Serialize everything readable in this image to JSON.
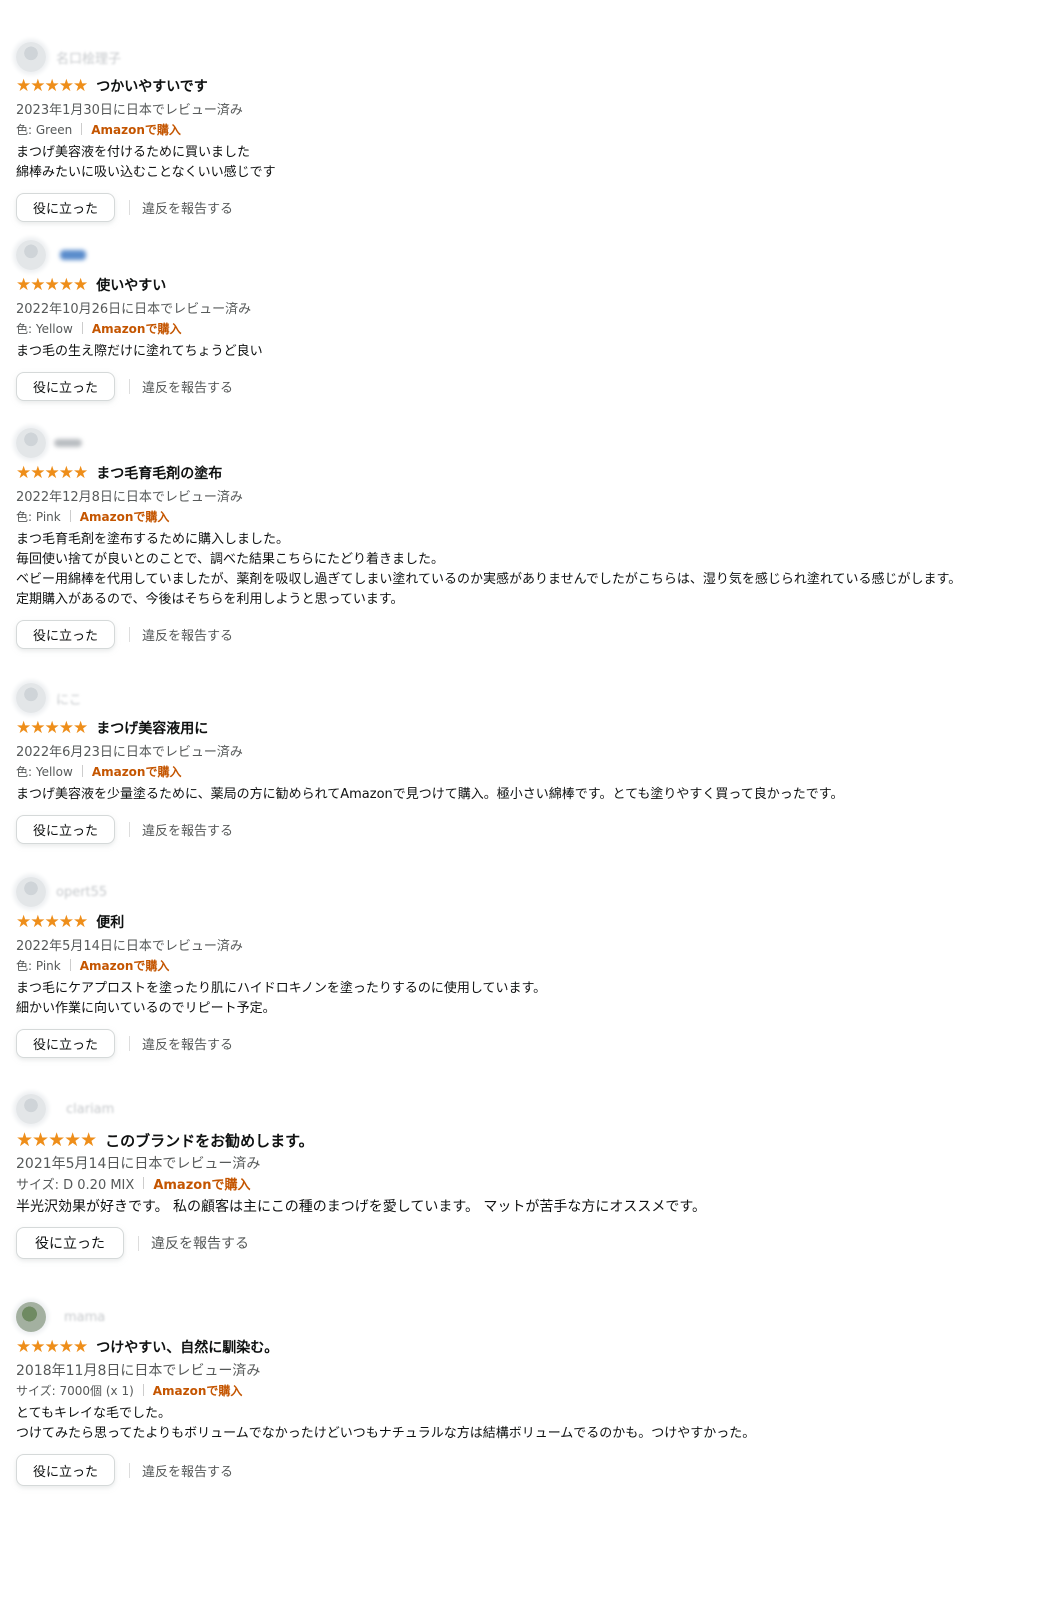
{
  "reviews": [
    {
      "profile_name": "名口桧理子",
      "stars": "★★★★★",
      "title": "つかいやすいです",
      "date": "2023年1月30日に日本でレビュー済み",
      "variant": "色: Green",
      "verified": "Amazonで購入",
      "body": [
        "まつげ美容液を付けるために買いました",
        "綿棒みたいに吸い込むことなくいい感じです"
      ],
      "helpful_label": "役に立った",
      "report_label": "違反を報告する"
    },
    {
      "profile_name": "",
      "stars": "★★★★★",
      "title": "使いやすい",
      "date": "2022年10月26日に日本でレビュー済み",
      "variant": "色: Yellow",
      "verified": "Amazonで購入",
      "body": [
        "まつ毛の生え際だけに塗れてちょうど良い"
      ],
      "helpful_label": "役に立った",
      "report_label": "違反を報告する"
    },
    {
      "profile_name": "",
      "stars": "★★★★★",
      "title": "まつ毛育毛剤の塗布",
      "date": "2022年12月8日に日本でレビュー済み",
      "variant": "色: Pink",
      "verified": "Amazonで購入",
      "body": [
        "まつ毛育毛剤を塗布するために購入しました。",
        "毎回使い捨てが良いとのことで、調べた結果こちらにたどり着きました。",
        "ベビー用綿棒を代用していましたが、薬剤を吸収し過ぎてしまい塗れているのか実感がありませんでしたがこちらは、湿り気を感じられ塗れている感じがします。",
        "定期購入があるので、今後はそちらを利用しようと思っています。"
      ],
      "helpful_label": "役に立った",
      "report_label": "違反を報告する"
    },
    {
      "profile_name": "にこ",
      "stars": "★★★★★",
      "title": "まつげ美容液用に",
      "date": "2022年6月23日に日本でレビュー済み",
      "variant": "色: Yellow",
      "verified": "Amazonで購入",
      "body": [
        "まつげ美容液を少量塗るために、薬局の方に勧められてAmazonで見つけて購入。極小さい綿棒です。とても塗りやすく買って良かったです。"
      ],
      "helpful_label": "役に立った",
      "report_label": "違反を報告する"
    },
    {
      "profile_name": "opert55",
      "stars": "★★★★★",
      "title": "便利",
      "date": "2022年5月14日に日本でレビュー済み",
      "variant": "色: Pink",
      "verified": "Amazonで購入",
      "body": [
        "まつ毛にケアプロストを塗ったり肌にハイドロキノンを塗ったりするのに使用しています。",
        "細かい作業に向いているのでリピート予定。"
      ],
      "helpful_label": "役に立った",
      "report_label": "違反を報告する"
    },
    {
      "profile_name": "clariam",
      "stars": "★★★★★",
      "title": "このブランドをお勧めします。",
      "date": "2021年5月14日に日本でレビュー済み",
      "variant": "サイズ: D 0.20 MIX",
      "verified": "Amazonで購入",
      "body": [
        "半光沢効果が好きです。 私の顧客は主にこの種のまつげを愛しています。 マットが苦手な方にオススメです。"
      ],
      "helpful_label": "役に立った",
      "report_label": "違反を報告する"
    },
    {
      "profile_name": "mama",
      "stars": "★★★★★",
      "title": "つけやすい、自然に馴染む。",
      "date": "2018年11月8日に日本でレビュー済み",
      "variant": "サイズ: 7000個 (x 1)",
      "verified": "Amazonで購入",
      "body": [
        "とてもキレイな毛でした。",
        "つけてみたら思ってたよりもボリュームでなかったけどいつもナチュラルな方は結構ボリュームでるのかも。つけやすかった。"
      ],
      "helpful_label": "役に立った",
      "report_label": "違反を報告する"
    }
  ]
}
